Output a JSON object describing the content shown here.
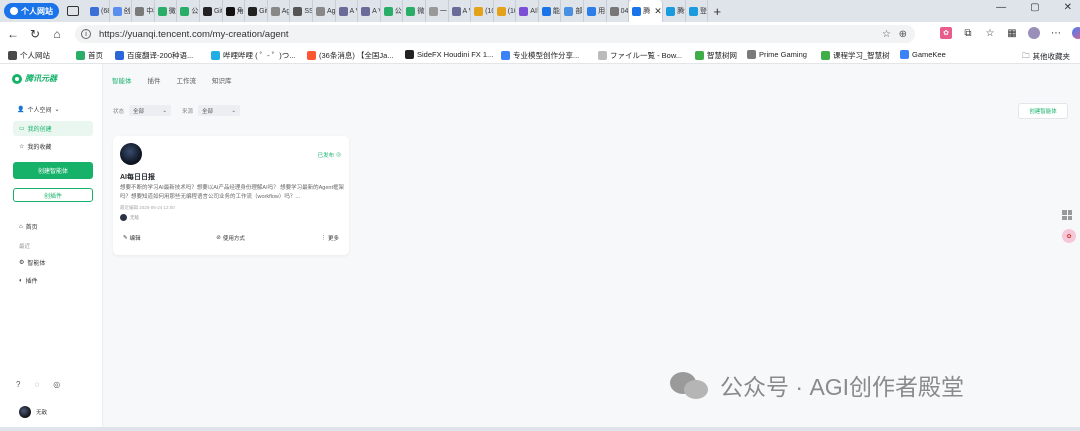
{
  "browser": {
    "profile_label": "个人网站",
    "tabs": [
      {
        "label": "(68",
        "color": "#3b6fd8"
      },
      {
        "label": "创",
        "color": "#5a8dee"
      },
      {
        "label": "中科",
        "color": "#7a7a7a"
      },
      {
        "label": "微信",
        "color": "#2aae67"
      },
      {
        "label": "公",
        "color": "#2aae67"
      },
      {
        "label": "Git",
        "color": "#222222"
      },
      {
        "label": "角色",
        "color": "#111111"
      },
      {
        "label": "Git",
        "color": "#222222"
      },
      {
        "label": "AgI",
        "color": "#888888"
      },
      {
        "label": "SSR",
        "color": "#555555"
      },
      {
        "label": "Ag",
        "color": "#888888"
      },
      {
        "label": "A V",
        "color": "#6b6b9a"
      },
      {
        "label": "A V",
        "color": "#6b6b9a"
      },
      {
        "label": "公众",
        "color": "#2aae67"
      },
      {
        "label": "微",
        "color": "#2aae67"
      },
      {
        "label": "一",
        "color": "#999999"
      },
      {
        "label": "A V",
        "color": "#6b6b9a"
      },
      {
        "label": "(10",
        "color": "#e3a21a"
      },
      {
        "label": "(10",
        "color": "#e3a21a"
      },
      {
        "label": "AI帮",
        "color": "#7b4fd6"
      },
      {
        "label": "能",
        "color": "#1a73e8"
      },
      {
        "label": "部",
        "color": "#4a90e2"
      },
      {
        "label": "用",
        "color": "#2b7de9"
      },
      {
        "label": "04(",
        "color": "#777777"
      },
      {
        "label": "腾",
        "color": "#1a73e8"
      }
    ],
    "active_tab_label": "",
    "trailing_tabs": [
      {
        "label": "腾讯",
        "color": "#1a9bdf"
      },
      {
        "label": "登",
        "color": "#1a9bdf"
      }
    ],
    "new_tab": "+",
    "url": "https://yuanqi.tencent.com/my-creation/agent",
    "bookmarks": [
      {
        "label": "个人网站",
        "color": "#4a4a4a"
      },
      {
        "label": "首页",
        "color": "#2aae67"
      },
      {
        "label": "百度翻译-200种语...",
        "color": "#2b66d9"
      },
      {
        "label": "哔哩哔哩 ( ゜- ゜)つ...",
        "color": "#23ade5"
      },
      {
        "label": "(36条消息) 【全国Ja...",
        "color": "#fc5531"
      },
      {
        "label": "SideFX Houdini FX 1...",
        "color": "#222222"
      },
      {
        "label": "专业模型创作分享...",
        "color": "#3b82f6"
      },
      {
        "label": "ファイル一覧 - Bow...",
        "color": "#bbbbbb"
      },
      {
        "label": "智慧树网",
        "color": "#3fae49"
      },
      {
        "label": "Prime Gaming",
        "color": "#7a7a7a"
      },
      {
        "label": "课程学习_智慧树",
        "color": "#3fae49"
      },
      {
        "label": "GameKee",
        "color": "#3b82f6"
      }
    ],
    "bookmarks_more": "其他收藏夹"
  },
  "sidebar": {
    "brand": "腾讯元器",
    "space_label": "个人空间",
    "my_creations": "我的创建",
    "my_favorites": "我的收藏",
    "create_button": "创建智能体",
    "plugin_button": "创插件",
    "home": "首页",
    "recent_label": "最近",
    "recent_agents": "智能体",
    "recent_plugins": "插件",
    "user_name": "无敌"
  },
  "main": {
    "tabs": [
      "智能体",
      "插件",
      "工作流",
      "知识库"
    ],
    "filter_status_label": "状态",
    "filter_status_value": "全部",
    "filter_source_label": "来源",
    "filter_source_value": "全部",
    "create_agent_button": "创建智能体"
  },
  "card": {
    "status": "已发布",
    "title": "AI每日日报",
    "description": "想要不断的学习AI最新技术吗？想要以AI产品经理身份理解AI吗？ 想要学习最新的Agent框架吗？想要知道如何用那些无编程语言公司业务的工作流（workflow）吗？...",
    "updated": "最近编辑 2025-06-24 12:00",
    "author": "无敌",
    "edit": "编辑",
    "usage": "使用方式",
    "more": "更多"
  },
  "watermark": "公众号 · AGI创作者殿堂"
}
